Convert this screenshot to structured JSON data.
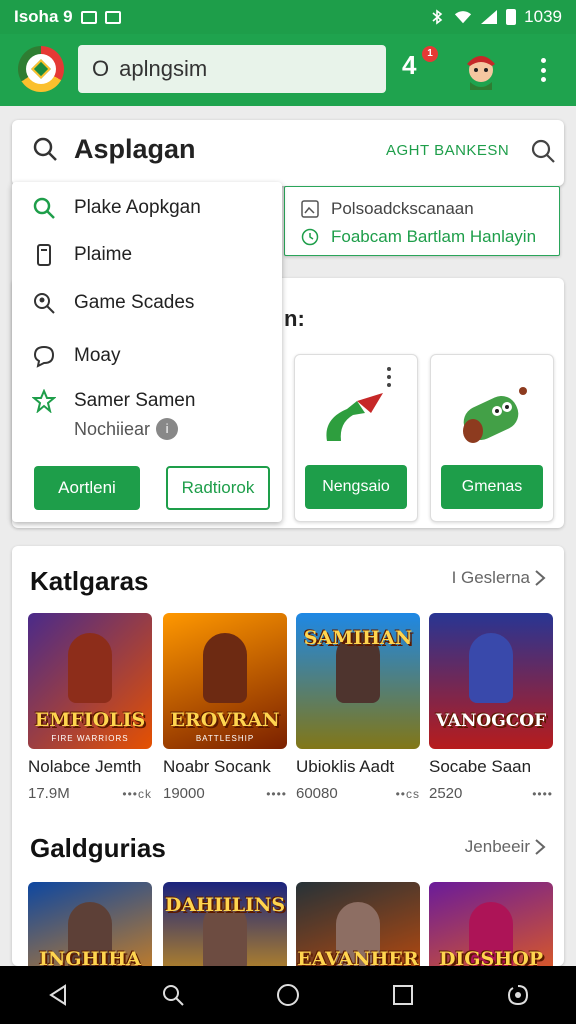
{
  "status_bar": {
    "left_text": "Isoha 9",
    "time": "1039"
  },
  "app_bar": {
    "search_prefix": "O",
    "search_value": "aplngsim",
    "notification_count": "1",
    "notification_glyph": "4"
  },
  "search_card": {
    "title": "Asplagan",
    "advanced_label": "AGHT BANKESN"
  },
  "popup_right": {
    "item1": "Polsoadckscanaan",
    "item2": "Foabcam Bartlam Hanlayin"
  },
  "dropdown": {
    "items": [
      {
        "label": "Plake Aopkgan",
        "icon": "search-icon"
      },
      {
        "label": "Plaime",
        "icon": "phone-icon"
      },
      {
        "label": "Game Scades",
        "icon": "search-user-icon"
      },
      {
        "label": "Moay",
        "icon": "chat-icon"
      },
      {
        "label": "Samer Samen",
        "icon": "star-icon"
      }
    ],
    "sub_label": "Nochiiear",
    "primary_button": "Aortleni",
    "outline_button": "Radtiorok"
  },
  "featured": {
    "heading_tail": "n:",
    "tiles": [
      {
        "button": "Nengsaio"
      },
      {
        "button": "Gmenas"
      }
    ]
  },
  "categories": {
    "title": "Katlgaras",
    "link": "I Geslerna",
    "games": [
      {
        "thumb_title": "EMFIOLIS",
        "thumb_sub": "FIRE WARRIORS",
        "name": "Nolabce Jemth",
        "downloads": "17.9M",
        "dots": "•••ck",
        "color_a": "#4a2a8a",
        "color_b": "#e65100"
      },
      {
        "thumb_title": "EROVRAN",
        "thumb_sub": "BATTLESHIP",
        "name": "Noabr Socank",
        "downloads": "19000",
        "dots": "••••",
        "color_a": "#e65100",
        "color_b": "#5d1a00"
      },
      {
        "thumb_title": "SAMIHAN",
        "thumb_sub": "",
        "name": "Ubioklis Aadt",
        "downloads": "60080",
        "dots": "••cs",
        "color_a": "#1565c0",
        "color_b": "#827717"
      },
      {
        "thumb_title": "VANOGCOF",
        "thumb_sub": "",
        "name": "Socabe Saan",
        "downloads": "2520",
        "dots": "••••",
        "color_a": "#1a237e",
        "color_b": "#c62828"
      }
    ]
  },
  "galleries": {
    "title": "Galdgurias",
    "link": "Jenbeeir",
    "games": [
      {
        "thumb_title": "INGHIHA",
        "color_a": "#0d47a1",
        "color_b": "#ff8f00"
      },
      {
        "thumb_title": "DAHIILINS",
        "color_a": "#1a237e",
        "color_b": "#ffb300"
      },
      {
        "thumb_title": "EAVANHER",
        "color_a": "#263238",
        "color_b": "#e65100"
      },
      {
        "thumb_title": "DIGSHOP",
        "color_a": "#6a1b9a",
        "color_b": "#ff6f00"
      }
    ]
  }
}
